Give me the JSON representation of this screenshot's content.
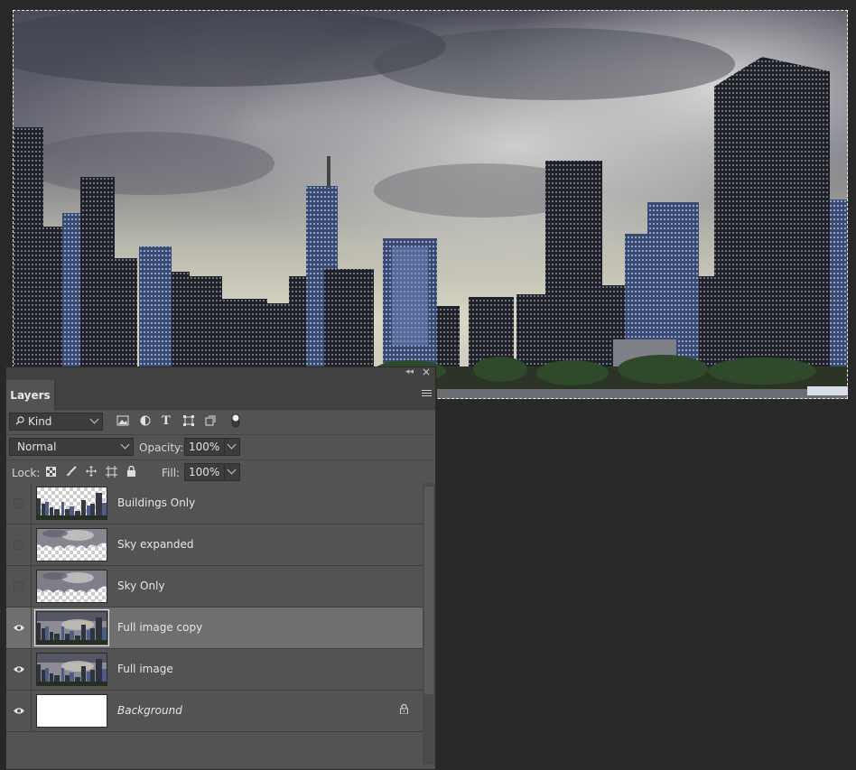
{
  "panel": {
    "tab_label": "Layers",
    "filter": {
      "kind_label": "Kind"
    },
    "blend_mode": "Normal",
    "opacity_label": "Opacity:",
    "opacity_value": "100%",
    "lock_label": "Lock:",
    "fill_label": "Fill:",
    "fill_value": "100%"
  },
  "icons": {
    "filter_types": [
      "image-filter-icon",
      "adjustment-filter-icon",
      "type-filter-icon",
      "shape-filter-icon",
      "smart-object-filter-icon",
      "filter-toggle-icon"
    ],
    "lock_types": [
      "lock-transparent-pixels-icon",
      "lock-image-pixels-icon",
      "lock-position-icon",
      "lock-artboard-icon",
      "lock-all-icon"
    ]
  },
  "layers": [
    {
      "name": "Buildings Only",
      "visible": false,
      "selected": false,
      "thumb": "buildings"
    },
    {
      "name": "Sky expanded",
      "visible": false,
      "selected": false,
      "thumb": "sky"
    },
    {
      "name": "Sky Only",
      "visible": false,
      "selected": false,
      "thumb": "sky"
    },
    {
      "name": "Full image copy",
      "visible": true,
      "selected": true,
      "thumb": "full"
    },
    {
      "name": "Full image",
      "visible": true,
      "selected": false,
      "thumb": "full"
    },
    {
      "name": "Background",
      "visible": true,
      "selected": false,
      "thumb": "white",
      "locked": true,
      "italic": true
    }
  ],
  "colors": {
    "app_bg": "#282828",
    "panel_bg": "#535353",
    "selected_row": "#6f6f6f"
  }
}
